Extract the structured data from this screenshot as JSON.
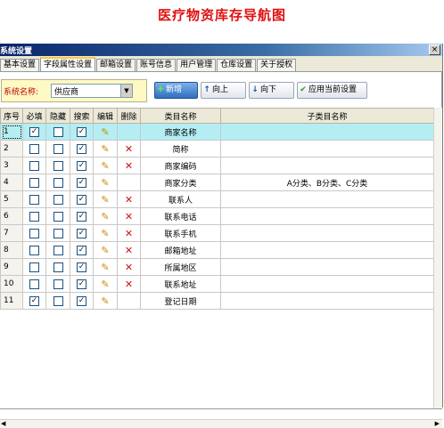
{
  "page_title": "医疗物资库存导航图",
  "window": {
    "title": "系统设置",
    "close_glyph": "×"
  },
  "tabs": [
    {
      "label": "基本设置"
    },
    {
      "label": "字段属性设置"
    },
    {
      "label": "邮箱设置"
    },
    {
      "label": "账号信息"
    },
    {
      "label": "用户管理"
    },
    {
      "label": "仓库设置"
    },
    {
      "label": "关于授权"
    }
  ],
  "active_tab": 1,
  "toolbar": {
    "system_label": "系统名称:",
    "system_value": "供应商",
    "add_label": "新增",
    "up_label": "向上",
    "down_label": "向下",
    "apply_label": "应用当前设置"
  },
  "columns": [
    "序号",
    "必填",
    "隐藏",
    "搜索",
    "编辑",
    "删除",
    "类目名称",
    "子类目名称"
  ],
  "rows": [
    {
      "seq": "1",
      "required": true,
      "hidden": false,
      "search": true,
      "edit": true,
      "delete": false,
      "name": "商家名称",
      "sub": ""
    },
    {
      "seq": "2",
      "required": false,
      "hidden": false,
      "search": true,
      "edit": true,
      "delete": true,
      "name": "简称",
      "sub": ""
    },
    {
      "seq": "3",
      "required": false,
      "hidden": false,
      "search": true,
      "edit": true,
      "delete": true,
      "name": "商家编码",
      "sub": ""
    },
    {
      "seq": "4",
      "required": false,
      "hidden": false,
      "search": true,
      "edit": true,
      "delete": false,
      "name": "商家分类",
      "sub": "A分类、B分类、C分类"
    },
    {
      "seq": "5",
      "required": false,
      "hidden": false,
      "search": true,
      "edit": true,
      "delete": true,
      "name": "联系人",
      "sub": ""
    },
    {
      "seq": "6",
      "required": false,
      "hidden": false,
      "search": true,
      "edit": true,
      "delete": true,
      "name": "联系电话",
      "sub": ""
    },
    {
      "seq": "7",
      "required": false,
      "hidden": false,
      "search": true,
      "edit": true,
      "delete": true,
      "name": "联系手机",
      "sub": ""
    },
    {
      "seq": "8",
      "required": false,
      "hidden": false,
      "search": true,
      "edit": true,
      "delete": true,
      "name": "邮箱地址",
      "sub": ""
    },
    {
      "seq": "9",
      "required": false,
      "hidden": false,
      "search": true,
      "edit": true,
      "delete": true,
      "name": "所属地区",
      "sub": ""
    },
    {
      "seq": "10",
      "required": false,
      "hidden": false,
      "search": true,
      "edit": true,
      "delete": true,
      "name": "联系地址",
      "sub": ""
    },
    {
      "seq": "11",
      "required": true,
      "hidden": false,
      "search": true,
      "edit": true,
      "delete": false,
      "name": "登记日期",
      "sub": ""
    }
  ],
  "selected_row": 0,
  "icons": {
    "edit": "pencil-icon",
    "delete": "delete-x-icon",
    "add": "plus-icon",
    "up": "arrow-up-icon",
    "down": "arrow-down-icon",
    "apply": "check-icon"
  },
  "colors": {
    "title": "#e01010",
    "selected_row": "#b4eef2",
    "system_label": "#c00000"
  }
}
